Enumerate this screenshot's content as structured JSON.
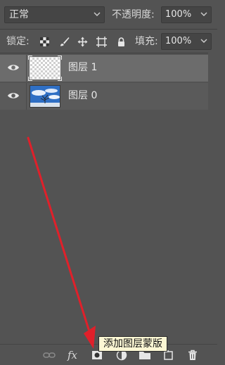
{
  "blend": {
    "mode": "正常"
  },
  "opacity": {
    "label": "不透明度:",
    "value": "100%"
  },
  "lock": {
    "label": "锁定:"
  },
  "fill": {
    "label": "填充:",
    "value": "100%"
  },
  "layers": [
    {
      "name": "图层 1",
      "selected": true,
      "thumb": "transparent"
    },
    {
      "name": "图层 0",
      "selected": false,
      "thumb": "sky-tree-photo"
    }
  ],
  "footer": {
    "icons": [
      "link-icon",
      "fx-icon",
      "add-mask-icon",
      "adjustment-icon",
      "folder-icon",
      "new-layer-icon",
      "trash-icon"
    ],
    "fx_label": "fx"
  },
  "tooltip": {
    "text": "添加图层蒙版"
  },
  "colors": {
    "panel": "#535353",
    "selected_layer": "#6c6c6c",
    "arrow": "#e0202a",
    "tooltip_bg": "#fcf7d4"
  }
}
